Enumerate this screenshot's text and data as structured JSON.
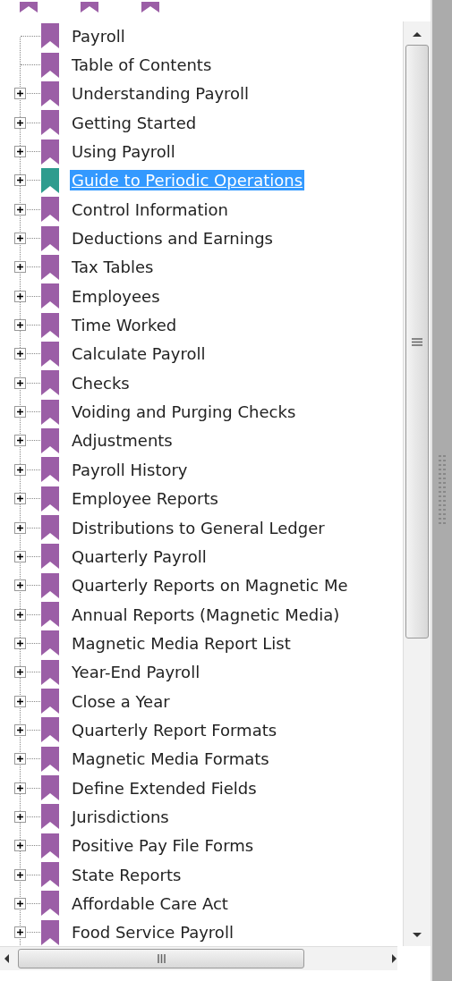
{
  "top_partial_icons": [
    {
      "kind": "bookmark"
    },
    {
      "kind": "bookmark"
    },
    {
      "kind": "bookmark"
    }
  ],
  "tree": [
    {
      "label": "Payroll",
      "kind": "leaf",
      "selected": false
    },
    {
      "label": "Table of Contents",
      "kind": "leaf",
      "selected": false
    },
    {
      "label": "Understanding Payroll",
      "kind": "node",
      "expanded": false,
      "selected": false
    },
    {
      "label": "Getting Started",
      "kind": "node",
      "expanded": false,
      "selected": false
    },
    {
      "label": "Using Payroll",
      "kind": "node",
      "expanded": false,
      "selected": false
    },
    {
      "label": "Guide to Periodic Operations",
      "kind": "node",
      "expanded": false,
      "selected": true
    },
    {
      "label": "Control Information",
      "kind": "node",
      "expanded": false,
      "selected": false
    },
    {
      "label": "Deductions and Earnings",
      "kind": "node",
      "expanded": false,
      "selected": false
    },
    {
      "label": "Tax Tables",
      "kind": "node",
      "expanded": false,
      "selected": false
    },
    {
      "label": "Employees",
      "kind": "node",
      "expanded": false,
      "selected": false
    },
    {
      "label": "Time Worked",
      "kind": "node",
      "expanded": false,
      "selected": false
    },
    {
      "label": "Calculate Payroll",
      "kind": "node",
      "expanded": false,
      "selected": false
    },
    {
      "label": "Checks",
      "kind": "node",
      "expanded": false,
      "selected": false
    },
    {
      "label": "Voiding and Purging Checks",
      "kind": "node",
      "expanded": false,
      "selected": false
    },
    {
      "label": "Adjustments",
      "kind": "node",
      "expanded": false,
      "selected": false
    },
    {
      "label": "Payroll History",
      "kind": "node",
      "expanded": false,
      "selected": false
    },
    {
      "label": "Employee Reports",
      "kind": "node",
      "expanded": false,
      "selected": false
    },
    {
      "label": "Distributions to General Ledger",
      "kind": "node",
      "expanded": false,
      "selected": false
    },
    {
      "label": "Quarterly Payroll",
      "kind": "node",
      "expanded": false,
      "selected": false
    },
    {
      "label": "Quarterly Reports on Magnetic Me",
      "kind": "node",
      "expanded": false,
      "selected": false
    },
    {
      "label": "Annual Reports (Magnetic Media)",
      "kind": "node",
      "expanded": false,
      "selected": false
    },
    {
      "label": "Magnetic Media Report List",
      "kind": "node",
      "expanded": false,
      "selected": false
    },
    {
      "label": "Year-End Payroll",
      "kind": "node",
      "expanded": false,
      "selected": false
    },
    {
      "label": "Close a Year",
      "kind": "node",
      "expanded": false,
      "selected": false
    },
    {
      "label": "Quarterly Report Formats",
      "kind": "node",
      "expanded": false,
      "selected": false
    },
    {
      "label": "Magnetic Media Formats",
      "kind": "node",
      "expanded": false,
      "selected": false
    },
    {
      "label": "Define Extended Fields",
      "kind": "node",
      "expanded": false,
      "selected": false
    },
    {
      "label": "Jurisdictions",
      "kind": "node",
      "expanded": false,
      "selected": false
    },
    {
      "label": "Positive Pay File Forms",
      "kind": "node",
      "expanded": false,
      "selected": false
    },
    {
      "label": "State Reports",
      "kind": "node",
      "expanded": false,
      "selected": false
    },
    {
      "label": "Affordable Care Act",
      "kind": "node",
      "expanded": false,
      "selected": false
    },
    {
      "label": "Food Service Payroll",
      "kind": "node",
      "expanded": false,
      "selected": false
    }
  ]
}
